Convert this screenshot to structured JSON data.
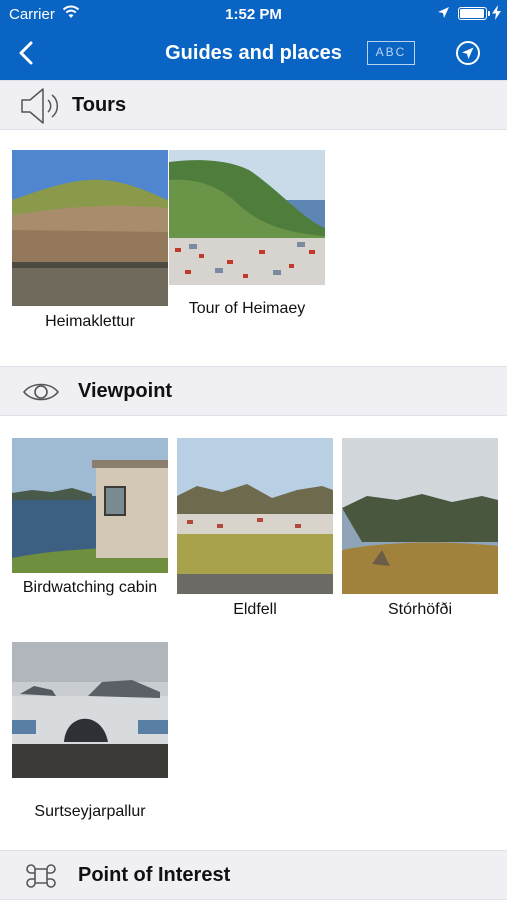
{
  "status_bar": {
    "carrier": "Carrier",
    "time": "1:52 PM"
  },
  "nav": {
    "title": "Guides and places",
    "abc_label": "ABC"
  },
  "sections": [
    {
      "title": "Tours",
      "icon": "speaker-icon",
      "items": [
        {
          "label": "Heimaklettur"
        },
        {
          "label": "Tour of Heimaey"
        }
      ]
    },
    {
      "title": "Viewpoint",
      "icon": "eye-icon",
      "items": [
        {
          "label": "Birdwatching cabin"
        },
        {
          "label": "Eldfell"
        },
        {
          "label": "Stórhöfði"
        },
        {
          "label": "Surtseyjarpallur"
        }
      ]
    },
    {
      "title": "Point of Interest",
      "icon": "command-icon",
      "items": []
    }
  ],
  "colors": {
    "nav_background": "#0a64c3",
    "section_background": "#efeff4"
  }
}
